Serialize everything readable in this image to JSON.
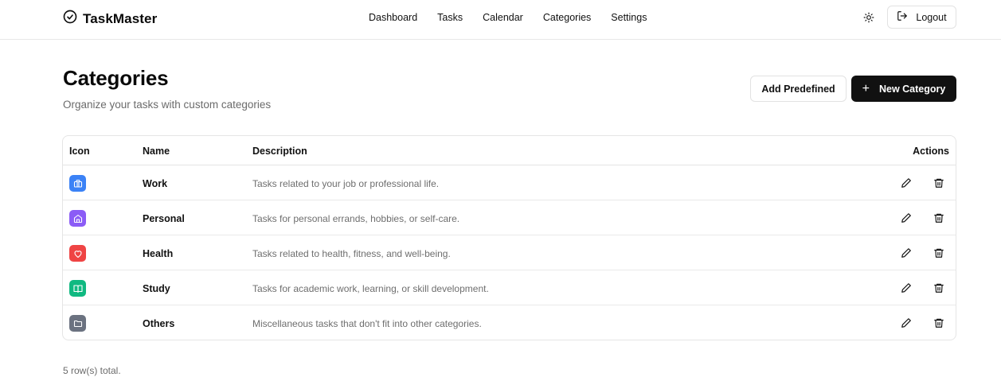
{
  "app": {
    "name": "TaskMaster",
    "logo_icon": "circle-check-icon"
  },
  "nav": [
    {
      "label": "Dashboard"
    },
    {
      "label": "Tasks"
    },
    {
      "label": "Calendar"
    },
    {
      "label": "Categories"
    },
    {
      "label": "Settings"
    }
  ],
  "header": {
    "theme_icon": "sun-icon",
    "logout_label": "Logout",
    "logout_icon": "log-out-icon"
  },
  "page": {
    "title": "Categories",
    "subtitle": "Organize your tasks with custom categories",
    "add_predefined_label": "Add Predefined",
    "new_category_label": "New Category",
    "new_category_icon": "plus-icon"
  },
  "table": {
    "columns": {
      "icon": "Icon",
      "name": "Name",
      "description": "Description",
      "actions": "Actions"
    },
    "rows": [
      {
        "icon": "briefcase-icon",
        "color": "#3b82f6",
        "name": "Work",
        "description": "Tasks related to your job or professional life."
      },
      {
        "icon": "home-icon",
        "color": "#8b5cf6",
        "name": "Personal",
        "description": "Tasks for personal errands, hobbies, or self-care."
      },
      {
        "icon": "heart-icon",
        "color": "#ef4444",
        "name": "Health",
        "description": "Tasks related to health, fitness, and well-being."
      },
      {
        "icon": "book-open-icon",
        "color": "#10b981",
        "name": "Study",
        "description": "Tasks for academic work, learning, or skill development."
      },
      {
        "icon": "folder-icon",
        "color": "#6b7280",
        "name": "Others",
        "description": "Miscellaneous tasks that don't fit into other categories."
      }
    ],
    "row_action_icons": [
      "pencil-icon",
      "trash-icon"
    ]
  },
  "footer": {
    "row_count_text": "5 row(s) total."
  }
}
